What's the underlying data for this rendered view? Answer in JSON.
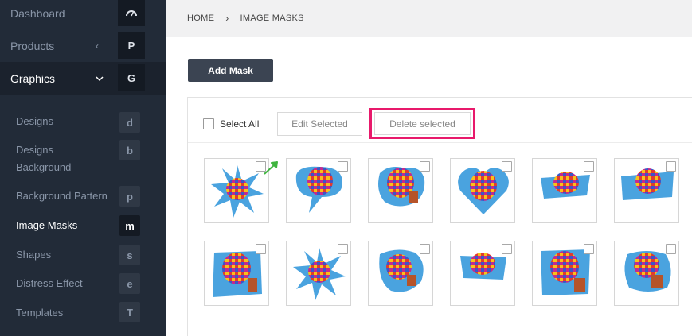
{
  "sidebar": {
    "top_items": [
      {
        "label": "Dashboard",
        "letter_icon": "dashboard-gauge-icon",
        "active": false
      },
      {
        "label": "Products",
        "chevron": "‹",
        "letter": "P",
        "active": false
      },
      {
        "label": "Graphics",
        "chevron": "⌄",
        "letter": "G",
        "active": true
      }
    ],
    "sub_items": [
      {
        "label": "Designs",
        "letter": "d",
        "active": false
      },
      {
        "label": "Designs",
        "label2": "Background",
        "letter": "b",
        "active": false
      },
      {
        "label": "Background Pattern",
        "letter": "p",
        "active": false
      },
      {
        "label": "Image Masks",
        "letter": "m",
        "active": true
      },
      {
        "label": "Shapes",
        "letter": "s",
        "active": false
      },
      {
        "label": "Distress Effect",
        "letter": "e",
        "active": false
      },
      {
        "label": "Templates",
        "letter": "T",
        "active": false
      }
    ]
  },
  "breadcrumb": {
    "home": "HOME",
    "separator": "›",
    "current": "IMAGE MASKS"
  },
  "toolbar": {
    "add_mask": "Add Mask",
    "select_all": "Select All",
    "edit_selected": "Edit Selected",
    "delete_selected": "Delete selected"
  },
  "colors": {
    "sidebar_bg": "#222b38",
    "highlight": "#e8196b",
    "button_dark": "#3b4452",
    "arrow": "#3fb43f"
  },
  "masks": [
    {
      "shape": "starburst"
    },
    {
      "shape": "speech-bubble"
    },
    {
      "shape": "brush-splash"
    },
    {
      "shape": "heart"
    },
    {
      "shape": "torn-strip"
    },
    {
      "shape": "brush-stroke"
    },
    {
      "shape": "grunge-frame"
    },
    {
      "shape": "starburst"
    },
    {
      "shape": "paint-splat"
    },
    {
      "shape": "torn-edge"
    },
    {
      "shape": "rough-square"
    },
    {
      "shape": "ink-splash"
    }
  ]
}
